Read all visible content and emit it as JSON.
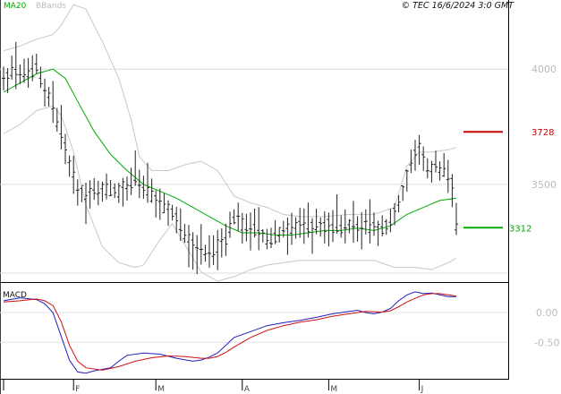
{
  "header": {
    "legend_ma": "MA20",
    "legend_bbands": "BBands",
    "credit": "© TEC 16/6/2024 3:0 GMT"
  },
  "colors": {
    "ma": "#00aa00",
    "bbands": "#c8c8c8",
    "candles": "#222222",
    "resistance": "#cc0000",
    "support": "#00aa00",
    "macd": "#1f1fbf",
    "signal": "#d01010"
  },
  "chart_data": [
    {
      "type": "line",
      "subtype": "ohlc_price_with_indicators",
      "title": "",
      "ylim": [
        3080,
        4300
      ],
      "yticks": [
        {
          "value": 4000,
          "label": "4000"
        },
        {
          "value": 3500,
          "label": "3500"
        }
      ],
      "x_ticks": [
        {
          "bar": 0,
          "label": ""
        },
        {
          "bar": 17,
          "label": "F"
        },
        {
          "bar": 37,
          "label": "M"
        },
        {
          "bar": 58,
          "label": "A"
        },
        {
          "bar": 79,
          "label": "M"
        },
        {
          "bar": 101,
          "label": "J"
        }
      ],
      "reference_lines": [
        {
          "name": "resistance",
          "value": 3728,
          "label": "3728"
        },
        {
          "name": "support",
          "value": 3312,
          "label": "3312"
        }
      ],
      "price_anchors": [
        [
          0,
          3950
        ],
        [
          2,
          3990
        ],
        [
          6,
          3970
        ],
        [
          8,
          4010
        ],
        [
          10,
          3920
        ],
        [
          12,
          3830
        ],
        [
          14,
          3710
        ],
        [
          16,
          3590
        ],
        [
          18,
          3480
        ],
        [
          20,
          3450
        ],
        [
          24,
          3480
        ],
        [
          28,
          3470
        ],
        [
          32,
          3520
        ],
        [
          35,
          3460
        ],
        [
          38,
          3420
        ],
        [
          40,
          3390
        ],
        [
          42,
          3360
        ],
        [
          44,
          3290
        ],
        [
          46,
          3240
        ],
        [
          48,
          3200
        ],
        [
          50,
          3200
        ],
        [
          52,
          3230
        ],
        [
          54,
          3250
        ],
        [
          55,
          3320
        ],
        [
          56,
          3360
        ],
        [
          58,
          3330
        ],
        [
          60,
          3320
        ],
        [
          62,
          3290
        ],
        [
          64,
          3270
        ],
        [
          66,
          3270
        ],
        [
          68,
          3300
        ],
        [
          70,
          3310
        ],
        [
          72,
          3320
        ],
        [
          76,
          3320
        ],
        [
          80,
          3320
        ],
        [
          84,
          3320
        ],
        [
          88,
          3320
        ],
        [
          92,
          3300
        ],
        [
          94,
          3330
        ],
        [
          96,
          3410
        ],
        [
          98,
          3530
        ],
        [
          100,
          3620
        ],
        [
          101,
          3650
        ],
        [
          103,
          3560
        ],
        [
          105,
          3580
        ],
        [
          107,
          3560
        ],
        [
          109,
          3500
        ],
        [
          110,
          3300
        ]
      ],
      "series": [
        {
          "name": "MA20",
          "points": [
            [
              0,
              3900
            ],
            [
              4,
              3940
            ],
            [
              8,
              3980
            ],
            [
              12,
              4000
            ],
            [
              15,
              3960
            ],
            [
              18,
              3860
            ],
            [
              22,
              3730
            ],
            [
              26,
              3630
            ],
            [
              30,
              3560
            ],
            [
              34,
              3500
            ],
            [
              38,
              3470
            ],
            [
              42,
              3440
            ],
            [
              46,
              3400
            ],
            [
              50,
              3360
            ],
            [
              54,
              3320
            ],
            [
              58,
              3290
            ],
            [
              62,
              3290
            ],
            [
              66,
              3280
            ],
            [
              70,
              3280
            ],
            [
              74,
              3290
            ],
            [
              78,
              3300
            ],
            [
              82,
              3300
            ],
            [
              86,
              3310
            ],
            [
              90,
              3300
            ],
            [
              94,
              3320
            ],
            [
              98,
              3370
            ],
            [
              102,
              3400
            ],
            [
              106,
              3430
            ],
            [
              110,
              3440
            ]
          ]
        },
        {
          "name": "BBands",
          "band": "upper",
          "points": [
            [
              0,
              4080
            ],
            [
              4,
              4100
            ],
            [
              8,
              4130
            ],
            [
              12,
              4150
            ],
            [
              14,
              4190
            ],
            [
              17,
              4280
            ],
            [
              20,
              4260
            ],
            [
              24,
              4120
            ],
            [
              28,
              3960
            ],
            [
              31,
              3780
            ],
            [
              33,
              3620
            ],
            [
              36,
              3560
            ],
            [
              40,
              3560
            ],
            [
              45,
              3590
            ],
            [
              48,
              3600
            ],
            [
              52,
              3560
            ],
            [
              56,
              3450
            ],
            [
              60,
              3420
            ],
            [
              64,
              3400
            ],
            [
              68,
              3370
            ],
            [
              72,
              3360
            ],
            [
              78,
              3360
            ],
            [
              84,
              3370
            ],
            [
              90,
              3370
            ],
            [
              95,
              3400
            ],
            [
              98,
              3580
            ],
            [
              101,
              3640
            ],
            [
              104,
              3640
            ],
            [
              108,
              3650
            ],
            [
              110,
              3660
            ]
          ]
        },
        {
          "name": "BBands",
          "band": "lower",
          "points": [
            [
              0,
              3720
            ],
            [
              4,
              3760
            ],
            [
              8,
              3820
            ],
            [
              12,
              3840
            ],
            [
              14,
              3800
            ],
            [
              17,
              3640
            ],
            [
              20,
              3410
            ],
            [
              24,
              3230
            ],
            [
              28,
              3160
            ],
            [
              32,
              3140
            ],
            [
              34,
              3150
            ],
            [
              38,
              3260
            ],
            [
              41,
              3330
            ],
            [
              44,
              3240
            ],
            [
              48,
              3120
            ],
            [
              52,
              3080
            ],
            [
              56,
              3100
            ],
            [
              60,
              3130
            ],
            [
              64,
              3150
            ],
            [
              68,
              3160
            ],
            [
              72,
              3170
            ],
            [
              78,
              3170
            ],
            [
              84,
              3170
            ],
            [
              90,
              3170
            ],
            [
              95,
              3140
            ],
            [
              100,
              3140
            ],
            [
              104,
              3130
            ],
            [
              108,
              3160
            ],
            [
              110,
              3180
            ]
          ]
        }
      ]
    },
    {
      "type": "line",
      "title": "MACD",
      "ylim": [
        -110,
        50
      ],
      "yticks": [
        {
          "value": 0,
          "label": "0.00"
        },
        {
          "value": -50,
          "label": "-0.50"
        }
      ],
      "series": [
        {
          "name": "MACD",
          "points": [
            [
              0,
              20
            ],
            [
              4,
              25
            ],
            [
              8,
              22
            ],
            [
              10,
              15
            ],
            [
              12,
              0
            ],
            [
              14,
              -40
            ],
            [
              16,
              -80
            ],
            [
              18,
              -100
            ],
            [
              20,
              -102
            ],
            [
              22,
              -98
            ],
            [
              26,
              -93
            ],
            [
              28,
              -82
            ],
            [
              30,
              -72
            ],
            [
              34,
              -68
            ],
            [
              38,
              -70
            ],
            [
              42,
              -77
            ],
            [
              46,
              -82
            ],
            [
              48,
              -80
            ],
            [
              50,
              -75
            ],
            [
              52,
              -68
            ],
            [
              54,
              -55
            ],
            [
              56,
              -42
            ],
            [
              60,
              -32
            ],
            [
              64,
              -22
            ],
            [
              68,
              -17
            ],
            [
              72,
              -13
            ],
            [
              76,
              -8
            ],
            [
              80,
              -2
            ],
            [
              84,
              2
            ],
            [
              86,
              4
            ],
            [
              88,
              0
            ],
            [
              90,
              -2
            ],
            [
              92,
              1
            ],
            [
              94,
              7
            ],
            [
              96,
              20
            ],
            [
              98,
              30
            ],
            [
              100,
              35
            ],
            [
              102,
              32
            ],
            [
              104,
              33
            ],
            [
              106,
              30
            ],
            [
              108,
              27
            ],
            [
              110,
              27
            ]
          ]
        },
        {
          "name": "Signal",
          "points": [
            [
              0,
              18
            ],
            [
              4,
              20
            ],
            [
              8,
              23
            ],
            [
              10,
              20
            ],
            [
              12,
              12
            ],
            [
              14,
              -15
            ],
            [
              16,
              -55
            ],
            [
              18,
              -82
            ],
            [
              20,
              -93
            ],
            [
              24,
              -97
            ],
            [
              28,
              -91
            ],
            [
              32,
              -82
            ],
            [
              36,
              -76
            ],
            [
              40,
              -73
            ],
            [
              44,
              -74
            ],
            [
              48,
              -77
            ],
            [
              50,
              -77
            ],
            [
              52,
              -74
            ],
            [
              54,
              -67
            ],
            [
              56,
              -58
            ],
            [
              60,
              -42
            ],
            [
              64,
              -30
            ],
            [
              68,
              -22
            ],
            [
              72,
              -16
            ],
            [
              76,
              -12
            ],
            [
              80,
              -6
            ],
            [
              84,
              -2
            ],
            [
              88,
              2
            ],
            [
              92,
              1
            ],
            [
              94,
              3
            ],
            [
              96,
              10
            ],
            [
              98,
              18
            ],
            [
              100,
              24
            ],
            [
              102,
              30
            ],
            [
              104,
              32
            ],
            [
              106,
              32
            ],
            [
              108,
              30
            ],
            [
              110,
              28
            ]
          ]
        }
      ]
    }
  ]
}
